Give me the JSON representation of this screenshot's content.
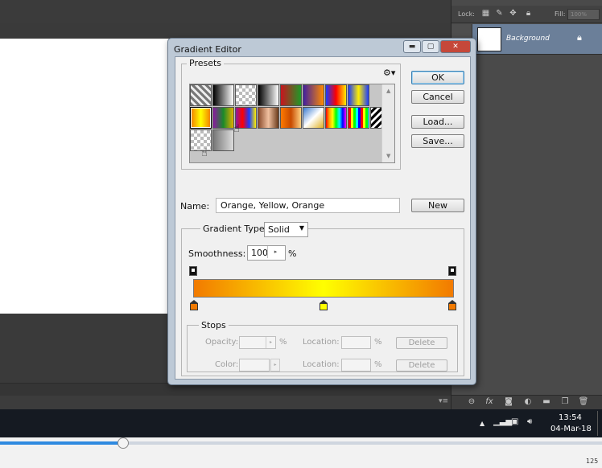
{
  "workspace": {
    "scroll_icon": "panel-menu-icon"
  },
  "layers_panel": {
    "lock_label": "Lock:",
    "fill_label": "Fill:",
    "fill_value": "100%",
    "layer_name": "Background",
    "icons": [
      "lock-transparent-icon",
      "lock-brush-icon",
      "lock-move-icon",
      "lock-all-icon"
    ],
    "footer_icons": [
      "link-icon",
      "fx-icon",
      "mask-icon",
      "adjustment-icon",
      "folder-icon",
      "new-layer-icon",
      "trash-icon"
    ]
  },
  "dialog": {
    "title": "Gradient Editor",
    "presets_label": "Presets",
    "buttons": {
      "ok": "OK",
      "cancel": "Cancel",
      "load": "Load...",
      "save": "Save...",
      "new": "New"
    },
    "name_label": "Name:",
    "name_value": "Orange, Yellow, Orange",
    "gradient_type_label": "Gradient Type:",
    "gradient_type_value": "Solid",
    "smoothness_label": "Smoothness:",
    "smoothness_value": "100",
    "smoothness_unit": "%",
    "gradient_colors": [
      "#f27a00",
      "#ffff00",
      "#f27a00"
    ],
    "stops": {
      "label": "Stops",
      "opacity_label": "Opacity:",
      "opacity_unit": "%",
      "location_label": "Location:",
      "location_unit": "%",
      "color_label": "Color:",
      "delete_label": "Delete"
    }
  },
  "taskbar": {
    "time": "13:54",
    "date": "04-Mar-18"
  },
  "player": {
    "progress": 0.205,
    "zoom_text": "125"
  }
}
